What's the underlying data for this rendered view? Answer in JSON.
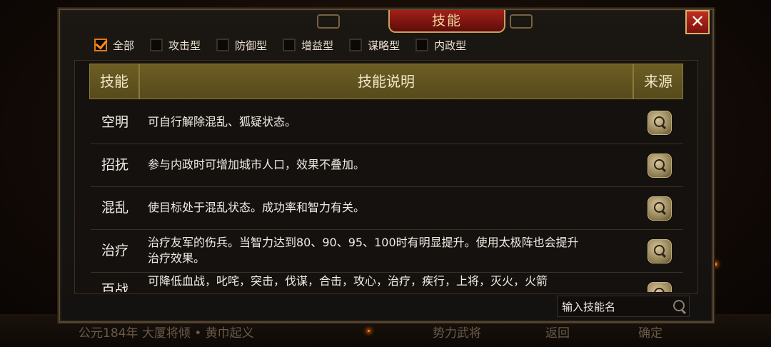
{
  "title": "技能",
  "close_icon": "close-icon",
  "filters": [
    {
      "label": "全部",
      "checked": true
    },
    {
      "label": "攻击型",
      "checked": false
    },
    {
      "label": "防御型",
      "checked": false
    },
    {
      "label": "增益型",
      "checked": false
    },
    {
      "label": "谋略型",
      "checked": false
    },
    {
      "label": "内政型",
      "checked": false
    }
  ],
  "table": {
    "headers": {
      "skill": "技能",
      "desc": "技能说明",
      "source": "来源"
    },
    "rows": [
      {
        "name": "空明",
        "desc": "可自行解除混乱、狐疑状态。"
      },
      {
        "name": "招抚",
        "desc": "参与内政时可增加城市人口，效果不叠加。"
      },
      {
        "name": "混乱",
        "desc": "使目标处于混乱状态。成功率和智力有关。"
      },
      {
        "name": "治疗",
        "desc": "治疗友军的伤兵。当智力达到80、90、95、100时有明显提升。使用太极阵也会提升治疗效果。"
      },
      {
        "name": "百战",
        "desc": "可降低血战，叱咤，突击，伐谋，合击，攻心，治疗，疾行，上将，灭火，火箭"
      }
    ]
  },
  "search": {
    "placeholder": "输入技能名"
  },
  "background": {
    "status_text": "公元184年 大厦将倾 • 黄巾起义",
    "btn_left": "势力武将",
    "btn_mid": "返回",
    "btn_right": "确定"
  },
  "colors": {
    "accent": "#ff8a14",
    "title_red": "#a32019",
    "header_olive": "#6d5e24"
  }
}
